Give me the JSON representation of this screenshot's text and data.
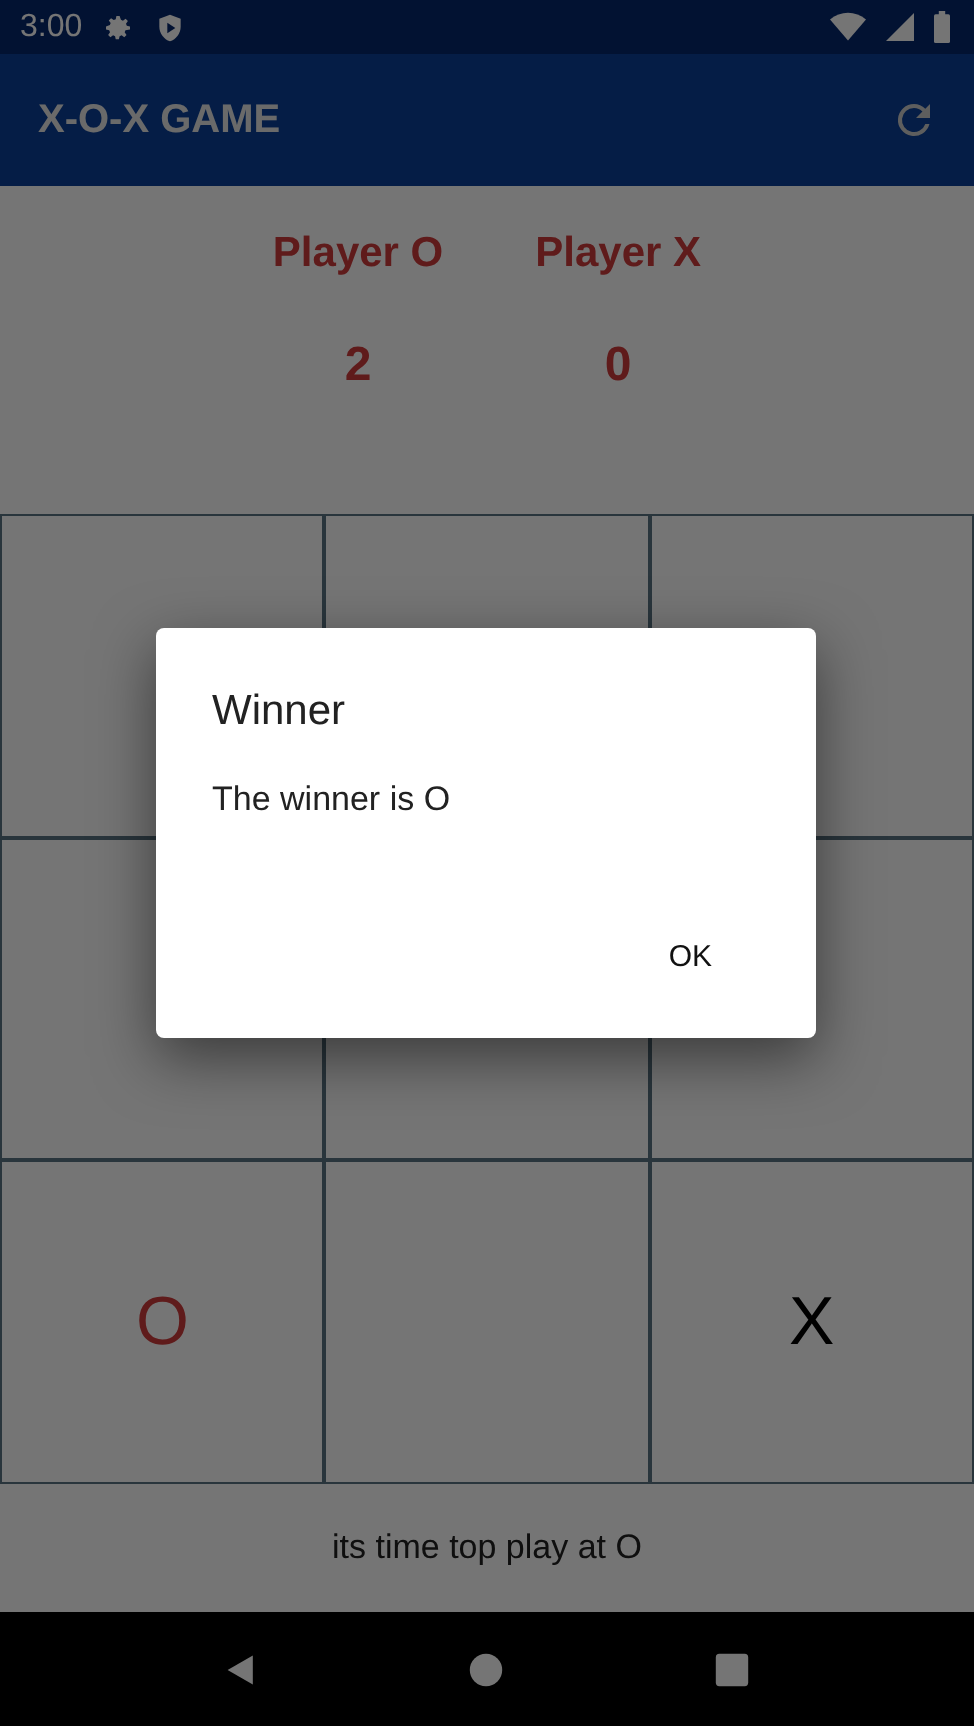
{
  "status_bar": {
    "time": "3:00"
  },
  "app_bar": {
    "title": "X-O-X GAME"
  },
  "players": [
    {
      "name": "Player O",
      "score": "2"
    },
    {
      "name": "Player X",
      "score": "0"
    }
  ],
  "board": [
    {
      "kind": "empty"
    },
    {
      "kind": "empty"
    },
    {
      "kind": "empty"
    },
    {
      "kind": "empty"
    },
    {
      "kind": "empty"
    },
    {
      "kind": "empty"
    },
    {
      "mark": "O",
      "kind": "o"
    },
    {
      "kind": "empty"
    },
    {
      "mark": "X",
      "kind": "x"
    }
  ],
  "footer": "its time top play at O",
  "dialog": {
    "title": "Winner",
    "message": "The winner is O",
    "button": "OK"
  }
}
